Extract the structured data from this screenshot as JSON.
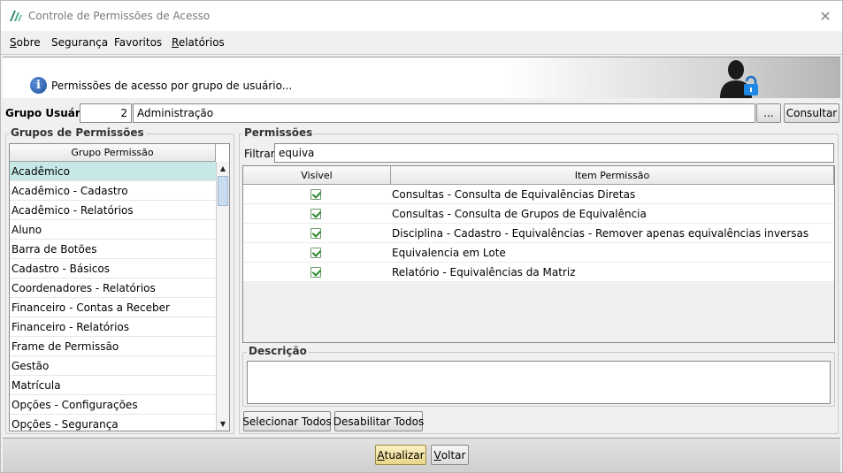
{
  "window": {
    "title": "Controle de Permissões de Acesso",
    "close_glyph": "✕"
  },
  "menu": {
    "items": [
      {
        "label_first": "S",
        "label_rest": "obre"
      },
      {
        "label_first": "",
        "label_rest": "Segurança"
      },
      {
        "label_first": "",
        "label_rest": "Favoritos"
      },
      {
        "label_first": "R",
        "label_rest": "elatórios"
      }
    ]
  },
  "banner": {
    "text": "Permissões de acesso por grupo de usuário...",
    "info_glyph": "i",
    "icon": "user-lock-icon"
  },
  "grupo_usuario": {
    "label": "Grupo Usuário:",
    "code": "2",
    "name": "Administração",
    "lookup_label": "...",
    "consultar_label": "Consultar"
  },
  "grupos_permissoes": {
    "title": "Grupos de Permissões",
    "column_header": "Grupo Permissão",
    "selected_index": 0,
    "items": [
      "Acadêmico",
      "Acadêmico - Cadastro",
      "Acadêmico - Relatórios",
      "Aluno",
      "Barra de Botões",
      "Cadastro - Básicos",
      "Coordenadores - Relatórios",
      "Financeiro - Contas a Receber",
      "Financeiro - Relatórios",
      "Frame de Permissão",
      "Gestão",
      "Matrícula",
      "Opções - Configurações",
      "Opções - Segurança"
    ]
  },
  "permissoes": {
    "title": "Permissões",
    "filter_label": "Filtrar:",
    "filter_value": "equiva",
    "columns": [
      "Visível",
      "Item Permissão"
    ],
    "rows": [
      {
        "visible": true,
        "item": "Consultas - Consulta de Equivalências Diretas"
      },
      {
        "visible": true,
        "item": "Consultas - Consulta de Grupos de Equivalência"
      },
      {
        "visible": true,
        "item": "Disciplina - Cadastro - Equivalências - Remover apenas equivalências inversas"
      },
      {
        "visible": true,
        "item": "Equivalencia em Lote"
      },
      {
        "visible": true,
        "item": "Relatório - Equivalências da Matriz"
      }
    ],
    "descricao_title": "Descrição",
    "descricao_value": "",
    "select_all_label": "Selecionar Todos",
    "disable_all_label": "Desabilitar Todos"
  },
  "footer": {
    "atualizar_first": "A",
    "atualizar_rest": "tualizar",
    "voltar_first": "V",
    "voltar_rest": "oltar"
  },
  "colors": {
    "selected_row": "#c6e8e6",
    "atualizar_bg": "#f3e6a8",
    "checkbox_green": "#2c8a2c"
  }
}
